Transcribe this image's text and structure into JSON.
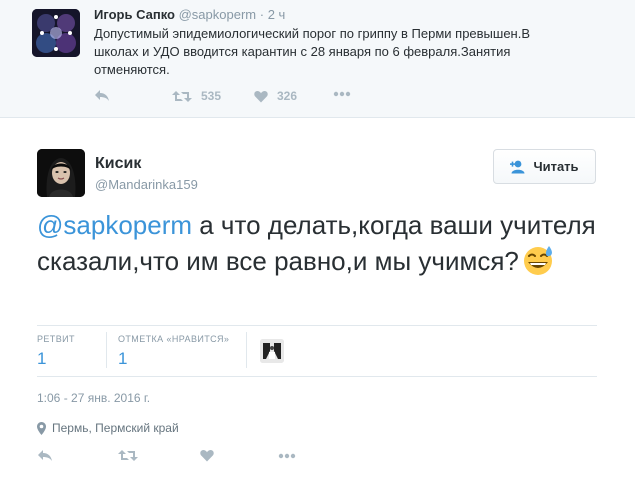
{
  "parent_tweet": {
    "author_name": "Игорь Сапко",
    "author_handle": "@sapkoperm",
    "time_ago": "· 2 ч",
    "text": "Допустимый эпидемиологический порог по гриппу в Перми превышен.В школах и УДО вводится карантин с 28 января по 6 февраля.Занятия отменяются.",
    "retweet_count": "535",
    "like_count": "326",
    "icons": [
      "reply-icon",
      "retweet-icon",
      "heart-icon",
      "more-icon"
    ]
  },
  "main_tweet": {
    "author_name": "Кисик",
    "author_handle": "@Mandarinka159",
    "follow_label": "Читать",
    "mention": "@sapkoperm",
    "text": " а что делать,когда ваши учителя сказали,что им все равно,и мы учимся?",
    "emoji": "grinning-face-with-sweat",
    "stats": {
      "retweets_label": "РЕТВИТ",
      "retweets_value": "1",
      "likes_label": "ОТМЕТКА «НРАВИТСЯ»",
      "likes_value": "1"
    },
    "timestamp": "1:06 - 27 янв. 2016 г.",
    "location": "Пермь, Пермский край",
    "icons": [
      "reply-icon",
      "retweet-icon",
      "heart-icon",
      "more-icon"
    ]
  },
  "colors": {
    "link": "#3b94d9",
    "muted": "#8899a6",
    "icon": "#aab8c2",
    "parent_bg": "#f5f8fa"
  }
}
